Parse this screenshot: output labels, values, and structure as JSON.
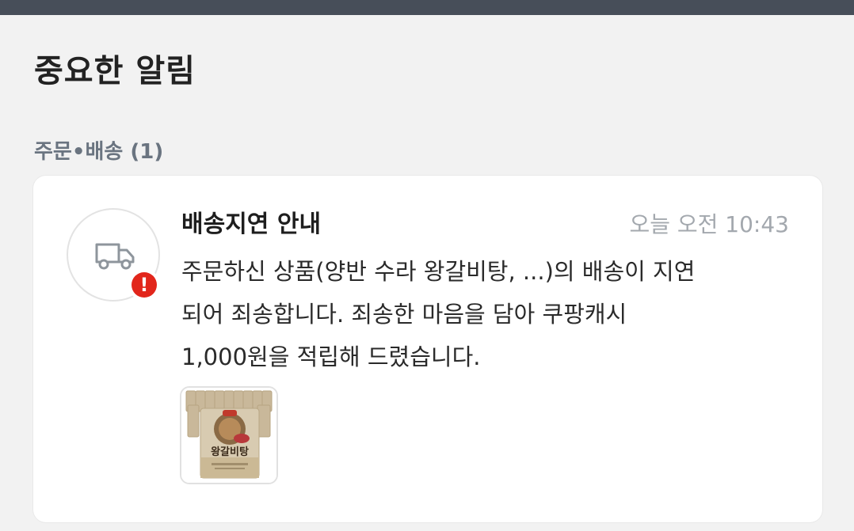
{
  "header": {
    "title": "중요한 알림"
  },
  "section": {
    "label": "주문•배송 (1)"
  },
  "notification": {
    "icon": "delivery-truck-icon",
    "badge_icon": "alert-exclamation-icon",
    "badge_text": "!",
    "title": "배송지연 안내",
    "time": "오늘 오전 10:43",
    "body_lines": [
      "주문하신 상품(양반 수라 왕갈비탕, ...)의 배송이 지연",
      "되어 죄송합니다. 죄송한 마음을 담아 쿠팡캐시",
      "1,000원을 적립해 드렸습니다."
    ],
    "product_image_label": "왕갈비탕"
  },
  "colors": {
    "topbar": "#474e59",
    "background": "#f2f2f2",
    "badge": "#e2261b",
    "time": "#a3a8ae",
    "section_label": "#6a7480"
  }
}
